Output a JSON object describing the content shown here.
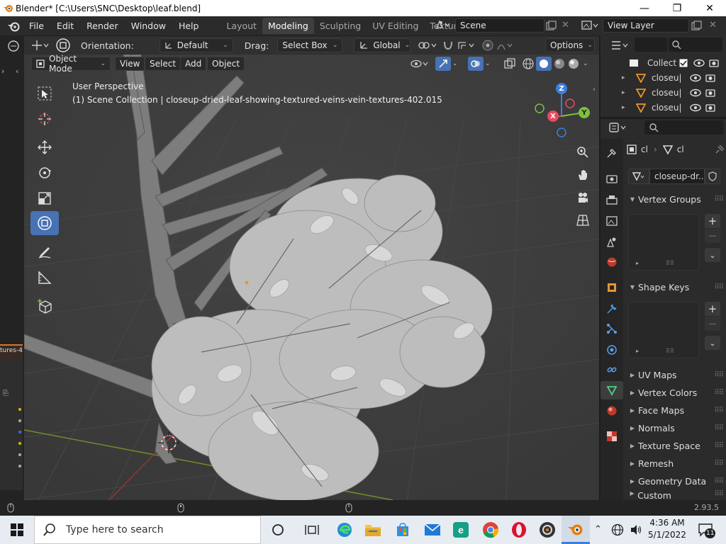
{
  "window": {
    "title": "Blender* [C:\\Users\\SNC\\Desktop\\leaf.blend]"
  },
  "menu": {
    "file": "File",
    "edit": "Edit",
    "render": "Render",
    "window": "Window",
    "help": "Help"
  },
  "workspaces": [
    "Layout",
    "Modeling",
    "Sculpting",
    "UV Editing",
    "Texture"
  ],
  "active_workspace": "Modeling",
  "scene": {
    "name": "Scene",
    "view_layer": "View Layer"
  },
  "tool_header": {
    "orientation_label": "Orientation:",
    "orientation_value": "Default",
    "drag_label": "Drag:",
    "drag_value": "Select Box",
    "transform_orientation": "Global",
    "options": "Options"
  },
  "view_header": {
    "mode": "Object Mode",
    "view": "View",
    "select": "Select",
    "add": "Add",
    "object": "Object"
  },
  "viewport": {
    "perspective": "User Perspective",
    "collection_info": "(1) Scene Collection | closeup-dried-leaf-showing-textured-veins-vein-textures-402.015",
    "gizmo": {
      "x": "X",
      "y": "Y",
      "z": "Z"
    }
  },
  "left_partial_label": "tures-4",
  "outliner": {
    "collection": "Collect",
    "items": [
      "closeu|",
      "closeu|",
      "closeu|"
    ]
  },
  "properties": {
    "breadcrumb_object": "cl",
    "breadcrumb_mesh": "cl",
    "mesh_name": "closeup-dr...",
    "sections": [
      "Vertex Groups",
      "Shape Keys",
      "UV Maps",
      "Vertex Colors",
      "Face Maps",
      "Normals",
      "Texture Space",
      "Remesh",
      "Geometry Data",
      "Custom Properties"
    ]
  },
  "status": {
    "version": "2.93.5"
  },
  "taskbar": {
    "search_placeholder": "Type here to search",
    "time": "4:36 AM",
    "date": "5/1/2022",
    "notifications": "11"
  },
  "colors": {
    "accent": "#4772b3",
    "viewport": "#3d3d3d",
    "axis_x": "#e84a5f",
    "axis_y": "#7dc13b",
    "axis_z": "#3b7ee0"
  }
}
